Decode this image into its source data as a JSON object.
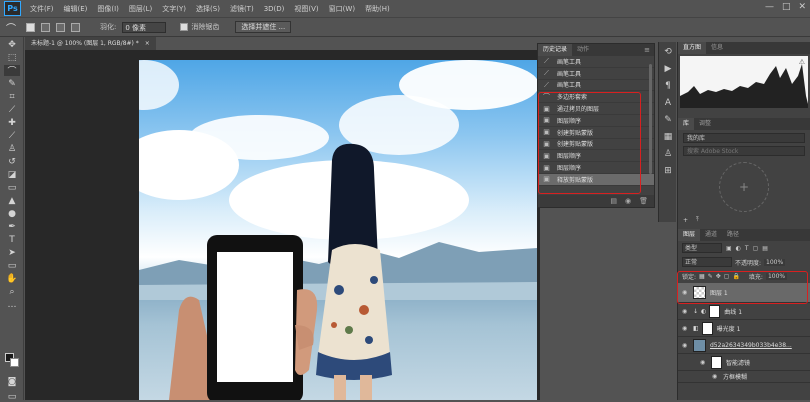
{
  "app": {
    "logo": "Ps"
  },
  "menu": [
    "文件(F)",
    "编辑(E)",
    "图像(I)",
    "图层(L)",
    "文字(Y)",
    "选择(S)",
    "滤镜(T)",
    "3D(D)",
    "视图(V)",
    "窗口(W)",
    "帮助(H)"
  ],
  "window_controls": [
    "—",
    "□",
    "✕"
  ],
  "options": {
    "feather_label": "羽化:",
    "feather_value": "0 像素",
    "antialias_label": "消除锯齿",
    "select_mask_button": "选择并遮住 ..."
  },
  "document": {
    "tab_title": "未标题-1 @ 100% (图层 1, RGB/8#) *",
    "close": "×"
  },
  "history": {
    "tabs": [
      "历史记录",
      "动作"
    ],
    "items": [
      {
        "label": "画笔工具",
        "icon": "brush-icon",
        "glyph": "⟋"
      },
      {
        "label": "画笔工具",
        "icon": "brush-icon",
        "glyph": "⟋"
      },
      {
        "label": "画笔工具",
        "icon": "brush-icon",
        "glyph": "⟋"
      },
      {
        "label": "多边形套索",
        "icon": "lasso-icon",
        "glyph": "⌒"
      },
      {
        "label": "通过拷贝的图层",
        "icon": "layer-icon",
        "glyph": "▣"
      },
      {
        "label": "图层顺序",
        "icon": "layer-icon",
        "glyph": "▣"
      },
      {
        "label": "创建剪贴蒙版",
        "icon": "layer-icon",
        "glyph": "▣"
      },
      {
        "label": "创建剪贴蒙版",
        "icon": "layer-icon",
        "glyph": "▣"
      },
      {
        "label": "图层顺序",
        "icon": "layer-icon",
        "glyph": "▣"
      },
      {
        "label": "图层顺序",
        "icon": "layer-icon",
        "glyph": "▣"
      },
      {
        "label": "释放剪贴蒙版",
        "icon": "layer-icon",
        "glyph": "▣"
      }
    ]
  },
  "histogram": {
    "tabs": [
      "直方图",
      "信息"
    ]
  },
  "libraries": {
    "tabs": [
      "库",
      "调整"
    ],
    "dropdown": "我的库",
    "search_placeholder": "搜索 Adobe Stock"
  },
  "layers": {
    "tabs": [
      "图层",
      "通道",
      "路径"
    ],
    "filter_kind": "类型",
    "blend_mode": "正常",
    "opacity_label": "不透明度:",
    "opacity_value": "100%",
    "lock_label": "锁定:",
    "fill_label": "填充:",
    "fill_value": "100%",
    "items": [
      {
        "name": "图层 1"
      },
      {
        "name": "曲线 1"
      },
      {
        "name": "曝光度 1"
      },
      {
        "name": "d52a2634349b033b4e38..."
      },
      {
        "name": "智能滤镜"
      },
      {
        "name": "方框模糊"
      }
    ]
  },
  "colors": {
    "bg": "#535353",
    "panel": "#424242",
    "highlight": "#d82020",
    "sky": "#8cc6f0"
  }
}
